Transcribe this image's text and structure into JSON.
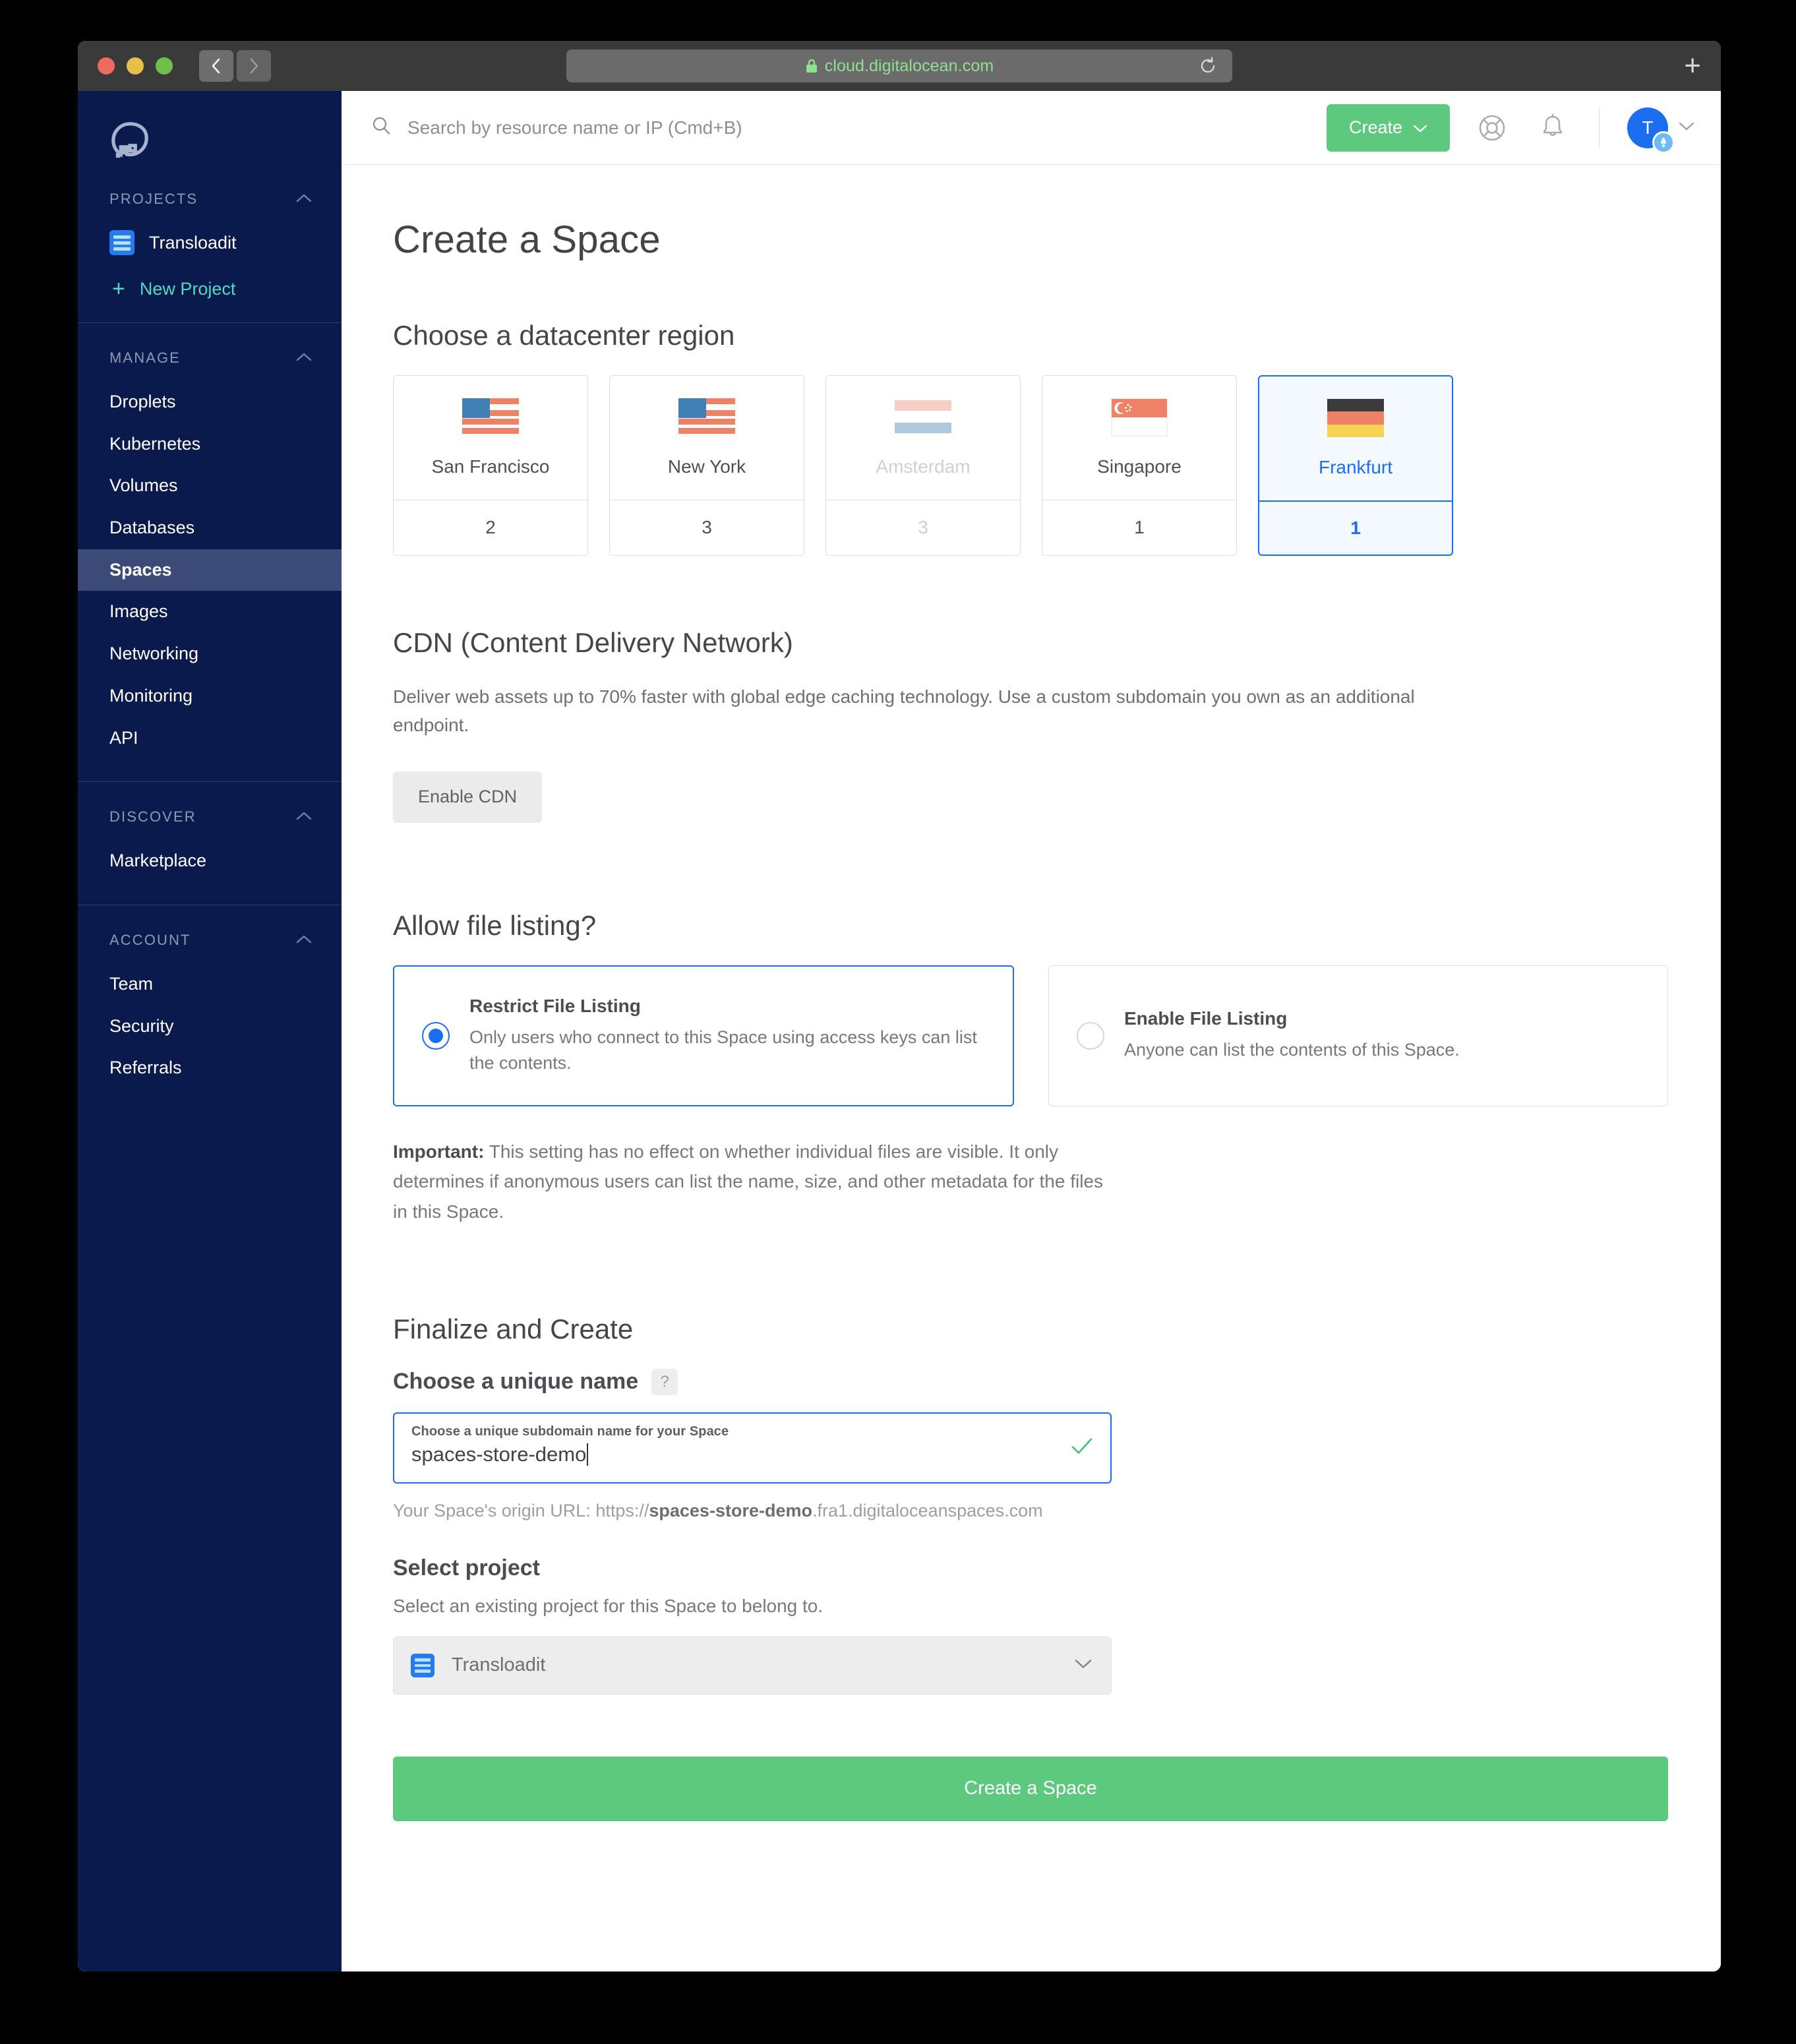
{
  "browser": {
    "url": "cloud.digitalocean.com",
    "lock_icon": "lock-icon",
    "back_icon": "chevron-left-icon",
    "forward_icon": "chevron-right-icon",
    "reload_icon": "reload-icon",
    "new_tab_label": "+"
  },
  "sidebar": {
    "logo": "digitalocean-logo",
    "sections": [
      {
        "title": "PROJECTS"
      },
      {
        "title": "MANAGE"
      },
      {
        "title": "DISCOVER"
      },
      {
        "title": "ACCOUNT"
      }
    ],
    "project": {
      "name": "Transloadit"
    },
    "new_project": {
      "plus": "+",
      "label": "New Project"
    },
    "manage_items": [
      {
        "label": "Droplets"
      },
      {
        "label": "Kubernetes"
      },
      {
        "label": "Volumes"
      },
      {
        "label": "Databases"
      },
      {
        "label": "Spaces"
      },
      {
        "label": "Images"
      },
      {
        "label": "Networking"
      },
      {
        "label": "Monitoring"
      },
      {
        "label": "API"
      }
    ],
    "active_item": "Spaces",
    "discover_items": [
      {
        "label": "Marketplace"
      }
    ],
    "account_items": [
      {
        "label": "Team"
      },
      {
        "label": "Security"
      },
      {
        "label": "Referrals"
      }
    ]
  },
  "topbar": {
    "search_placeholder": "Search by resource name or IP (Cmd+B)",
    "search_value": "",
    "create_label": "Create",
    "create_color": "#5cc97f",
    "help_icon": "lifebuoy-icon",
    "bell_icon": "bell-icon",
    "avatar_initial": "T",
    "avatar_color": "#1d6df0"
  },
  "page": {
    "title": "Create a Space"
  },
  "region_section": {
    "heading": "Choose a datacenter region",
    "regions": [
      {
        "name": "San Francisco",
        "count": "2",
        "flag": "us-flag",
        "state": "enabled"
      },
      {
        "name": "New York",
        "count": "3",
        "flag": "us-flag",
        "state": "enabled"
      },
      {
        "name": "Amsterdam",
        "count": "3",
        "flag": "nl-flag",
        "state": "disabled"
      },
      {
        "name": "Singapore",
        "count": "1",
        "flag": "sg-flag",
        "state": "enabled"
      },
      {
        "name": "Frankfurt",
        "count": "1",
        "flag": "de-flag",
        "state": "selected"
      }
    ],
    "selected_color": "#1b6ef3"
  },
  "cdn_section": {
    "heading": "CDN (Content Delivery Network)",
    "description": "Deliver web assets up to 70% faster with global edge caching technology. Use a custom subdomain you own as an additional endpoint.",
    "button_label": "Enable CDN"
  },
  "listing_section": {
    "heading": "Allow file listing?",
    "options": [
      {
        "title": "Restrict File Listing",
        "description": "Only users who connect to this Space using access keys can list the contents.",
        "selected": true
      },
      {
        "title": "Enable File Listing",
        "description": "Anyone can list the contents of this Space.",
        "selected": false
      }
    ],
    "important_label": "Important:",
    "important_text": " This setting has no effect on whether individual files are visible. It only determines if anonymous users can list the name, size, and other metadata for the files in this Space."
  },
  "finalize_section": {
    "heading": "Finalize and Create",
    "name_label": "Choose a unique name",
    "help_badge": "?",
    "field_label": "Choose a unique subdomain name for your Space",
    "field_value": "spaces-store-demo",
    "valid_icon": "checkmark-icon",
    "origin_prefix": "Your Space's origin URL: https://",
    "origin_bold": "spaces-store-demo",
    "origin_suffix": ".fra1.digitaloceanspaces.com",
    "select_heading": "Select project",
    "select_description": "Select an existing project for this Space to belong to.",
    "selected_project": "Transloadit",
    "dropdown_icon": "chevron-down-icon",
    "submit_label": "Create a Space"
  }
}
